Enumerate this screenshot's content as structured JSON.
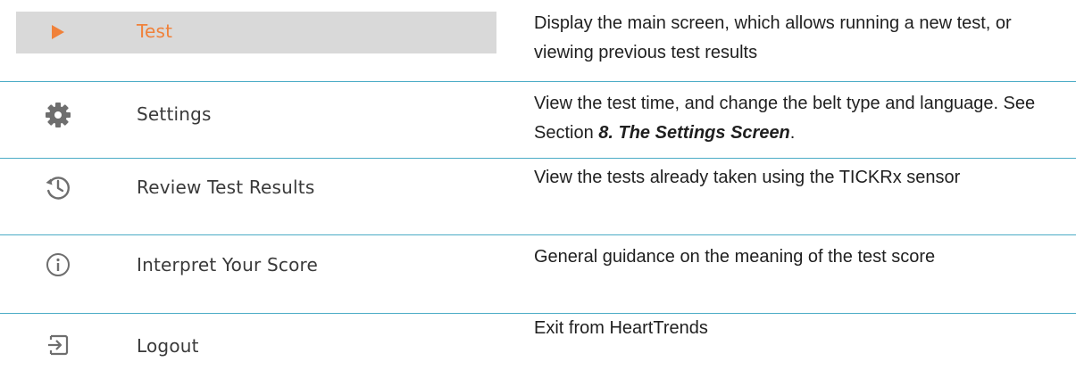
{
  "rows": [
    {
      "menu_label": "Test",
      "icon": "play-icon",
      "active": true,
      "description": "Display the main screen, which allows running a new test, or viewing previous test results"
    },
    {
      "menu_label": "Settings",
      "icon": "gear-icon",
      "active": false,
      "description_prefix": "View the test time, and change the belt type and language. See Section ",
      "description_emphasis": "8. The Settings Screen",
      "description_suffix": "."
    },
    {
      "menu_label": "Review Test Results",
      "icon": "history-icon",
      "active": false,
      "description": "View the tests already taken using the TICKRx sensor"
    },
    {
      "menu_label": "Interpret Your Score",
      "icon": "info-icon",
      "active": false,
      "description": "General guidance on the meaning of the test score"
    },
    {
      "menu_label": "Logout",
      "icon": "logout-icon",
      "active": false,
      "description": "Exit from HeartTrends"
    }
  ],
  "colors": {
    "active_label": "#f0813a",
    "active_background": "#d9d9d9",
    "icon_gray": "#6e6e6e",
    "divider": "#4bacc6"
  }
}
